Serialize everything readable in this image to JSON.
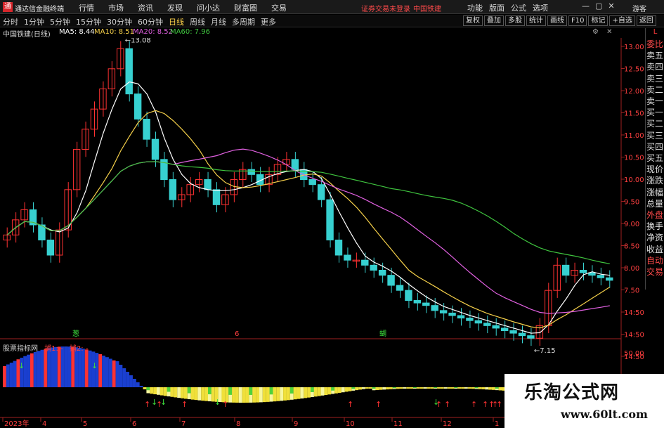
{
  "app": {
    "title": "通达信金融终端",
    "logo_glyph": "通",
    "menu": [
      "行情",
      "市场",
      "资讯",
      "发现",
      "问小达",
      "财富圈",
      "交易"
    ],
    "notice": "证券交易未登录",
    "current_stock": "中国铁建",
    "right_menu": [
      "功能",
      "版面",
      "公式",
      "选项"
    ],
    "window_controls": [
      "—",
      "▢",
      "✕"
    ],
    "guest": "游客"
  },
  "periods": {
    "items": [
      "分时",
      "1分钟",
      "5分钟",
      "15分钟",
      "30分钟",
      "60分钟",
      "日线",
      "周线",
      "月线",
      "多周期",
      "更多"
    ],
    "active": "日线"
  },
  "toolbar": [
    "复权",
    "叠加",
    "多股",
    "统计",
    "画线",
    "F10",
    "标记",
    "+自选",
    "返回"
  ],
  "stock": {
    "name": "中国铁建(日线)",
    "ma5": "MA5: 8.44",
    "ma10": "MA10: 8.51",
    "ma20": "MA20: 8.52",
    "ma60": "MA60: 7.96"
  },
  "colors": {
    "ma5": "#ffffff",
    "ma10": "#f5d04a",
    "ma20": "#e060e0",
    "ma60": "#3fc43f",
    "up": "#ff3232",
    "down": "#37d0d0",
    "price_axis": "#ff4040"
  },
  "side_header": "L",
  "side_items": [
    {
      "label": "委比",
      "tone": "red"
    },
    {
      "label": "卖五",
      "tone": ""
    },
    {
      "label": "卖四",
      "tone": ""
    },
    {
      "label": "卖三",
      "tone": ""
    },
    {
      "label": "卖二",
      "tone": ""
    },
    {
      "label": "卖一",
      "tone": ""
    },
    {
      "label": "买一",
      "tone": ""
    },
    {
      "label": "买二",
      "tone": ""
    },
    {
      "label": "买三",
      "tone": ""
    },
    {
      "label": "买四",
      "tone": ""
    },
    {
      "label": "买五",
      "tone": ""
    },
    {
      "label": "现价",
      "tone": ""
    },
    {
      "label": "涨跌",
      "tone": ""
    },
    {
      "label": "涨幅",
      "tone": ""
    },
    {
      "label": "总量",
      "tone": ""
    },
    {
      "label": "外盘",
      "tone": "red"
    },
    {
      "label": "换手",
      "tone": ""
    },
    {
      "label": "净资",
      "tone": ""
    },
    {
      "label": "收益",
      "tone": ""
    },
    {
      "label": "自动",
      "tone": "red"
    },
    {
      "label": "交易",
      "tone": "red"
    }
  ],
  "indicator": {
    "name": "股票指标网",
    "s1": "捕1: -",
    "s2": "捕2: -",
    "axis_value": "50.00"
  },
  "watermark": {
    "main": "乐淘公式网",
    "url": "www.60lt.com"
  },
  "chart_data": {
    "type": "candlestick",
    "y_ticks": [
      "13.00",
      "12.50",
      "12.00",
      "11.50",
      "11.00",
      "10.50",
      "10.00",
      "9.50",
      "9.00",
      "8.50",
      "8.00",
      "7.50",
      "14:50",
      "14:50",
      "14:50"
    ],
    "ylim": [
      7.15,
      13.08
    ],
    "high_label": "13.08",
    "low_label": "7.15",
    "x_ticks": [
      "2023年",
      "4",
      "5",
      "6",
      "7",
      "8",
      "9",
      "10",
      "11",
      "12",
      "1"
    ],
    "event_marks": [
      "葱",
      "6",
      "蝴"
    ],
    "close": [
      9.3,
      9.6,
      9.8,
      9.5,
      9.2,
      8.9,
      9.4,
      10.2,
      11.0,
      11.4,
      11.8,
      12.2,
      12.6,
      13.0,
      12.1,
      11.6,
      11.2,
      10.8,
      10.4,
      10.0,
      10.1,
      10.3,
      10.4,
      10.2,
      9.9,
      10.1,
      10.4,
      10.6,
      10.5,
      10.3,
      10.5,
      10.7,
      10.8,
      10.6,
      10.4,
      10.3,
      10.0,
      9.2,
      8.9,
      8.8,
      8.8,
      8.7,
      8.6,
      8.5,
      8.3,
      8.2,
      8.0,
      7.95,
      7.9,
      7.8,
      7.75,
      7.7,
      7.65,
      7.6,
      7.55,
      7.5,
      7.45,
      7.4,
      7.35,
      7.3,
      7.25,
      7.5,
      8.2,
      8.7,
      8.5,
      8.6,
      8.55,
      8.5,
      8.45,
      8.4
    ],
    "markers_up": 13,
    "markers_down": 6
  }
}
